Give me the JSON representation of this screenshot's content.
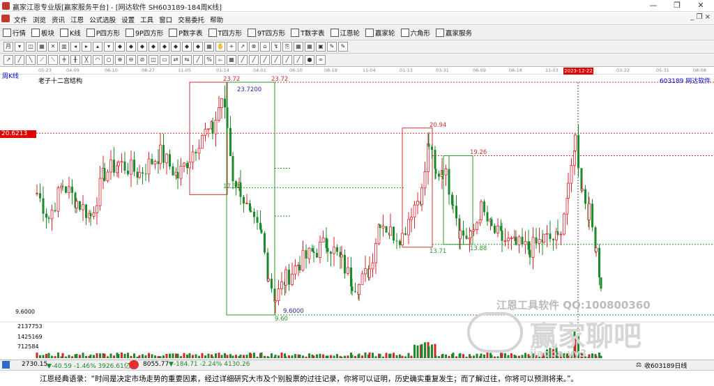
{
  "window": {
    "title": "赢家江恩专业版[赢家服务平台] - [网达软件  SH603189-184周K线]",
    "buttons": {
      "minimize": "—",
      "restore": "❐",
      "close": "✕"
    },
    "mdi_buttons": "_ ❐ ×"
  },
  "menu": [
    "文件",
    "浏览",
    "资讯",
    "江恩",
    "公式选股",
    "设置",
    "工具",
    "窗口",
    "交易委托",
    "帮助"
  ],
  "toolbar1": [
    {
      "label": "行情",
      "icon": "grid-icon"
    },
    {
      "label": "板块",
      "icon": "blocks-icon"
    },
    {
      "label": "K线",
      "icon": "candle-icon"
    },
    {
      "label": "P四方形",
      "icon": "p4-icon"
    },
    {
      "label": "9P四方形",
      "icon": "9p4-icon"
    },
    {
      "label": "P数字表",
      "icon": "pnum-icon"
    },
    {
      "label": "T四方形",
      "icon": "t4-icon"
    },
    {
      "label": "9T四方形",
      "icon": "9t4-icon"
    },
    {
      "label": "T数字表",
      "icon": "tnum-icon"
    },
    {
      "label": "江恩轮",
      "icon": "gann-wheel-icon"
    },
    {
      "label": "赢家轮",
      "icon": "winner-wheel-icon"
    },
    {
      "label": "六角形",
      "icon": "hexagon-icon"
    },
    {
      "label": "赢家服务",
      "icon": "dollar-icon"
    }
  ],
  "toolbar2_glyphs": [
    "月",
    "▾",
    "◫",
    "▦",
    "✕",
    "▥",
    "◂",
    "▸",
    "▴",
    "▾",
    "◆",
    "◆",
    "◆",
    "◆",
    "◆",
    "◆",
    "◆",
    "◆",
    "▦",
    "✋",
    "+",
    "↗",
    "⊗",
    "⌂",
    "↯",
    "⎘",
    "▦",
    "▦",
    "▣",
    "✎",
    "✎"
  ],
  "toolbar3_glyphs": [
    "↗",
    "╱",
    "╲",
    "⟋",
    "⟍",
    "╪",
    "╫",
    "╳",
    "◠",
    "○",
    "⊕",
    "⊖",
    "⊘",
    "◫",
    "▭",
    "⇄",
    "⇆",
    "╱",
    "%",
    "⟜",
    "▦",
    "╱",
    "╱",
    "╱",
    "╱",
    "╱",
    "╱",
    "●",
    "∞"
  ],
  "chart": {
    "period_label": "周K线",
    "study_label": "老子十二宫结构",
    "stock_label": "603189  网达软件",
    "price_marker": "20.6213",
    "cursor_date": "2023-12-22",
    "dates": [
      "05-23",
      "04-09",
      "06-10",
      "08-27",
      "11-05",
      "01-14",
      "04-01",
      "06-10",
      "08-19",
      "11-04",
      "01-13",
      "03-31",
      "06-09",
      "08-18",
      "11-03",
      "2023-12-22",
      "03-22",
      "05-31",
      "08-08"
    ],
    "low_label": "9.6000",
    "box_labels": {
      "top1": "23.72",
      "top2": "23.7200",
      "top3": "23.72",
      "mid1": "17.32",
      "low1": "9.60",
      "low2": "9.6000",
      "box2_top": "20.94",
      "box2_low": "13.71",
      "box3_top": "19.26",
      "box3_low": "13.88"
    },
    "volume_ticks": [
      "2137753",
      "1425169",
      "712584"
    ],
    "watermark": "江恩工具软件  QQ:100800360",
    "watermark2": "赢家聊吧",
    "watermark3": "jiaoba.yy3"
  },
  "chart_data": {
    "type": "candlestick",
    "title": "老子十二宫结构",
    "ylim": [
      9.6,
      23.72
    ],
    "annotated_levels": [
      23.72,
      20.94,
      19.26,
      17.32,
      13.88,
      13.71,
      9.6
    ],
    "current_marker": 20.6213,
    "volume_ticks": [
      712584,
      1425169,
      2137753
    ]
  },
  "status": {
    "index1": "2730.15",
    "index1_change": "▼-40.59 -1.46% 3926.61亿",
    "index2": "8055.77",
    "index2_change": "▼-184.71 -2.24% 4130.26",
    "right": "收603189日线"
  },
  "quote": "江恩经典语录：“时间是决定市场走势的重要因素，经过详细研究大市及个别股票的过往记录，你将可以证明，历史确实重复发生；而了解过往，你将可以预测将来。”。",
  "colors": {
    "up": "#e0202a",
    "down": "#1a8a2a",
    "marker": "#e00000",
    "box_red": "#d03030",
    "box_green": "#2a9a2a"
  }
}
